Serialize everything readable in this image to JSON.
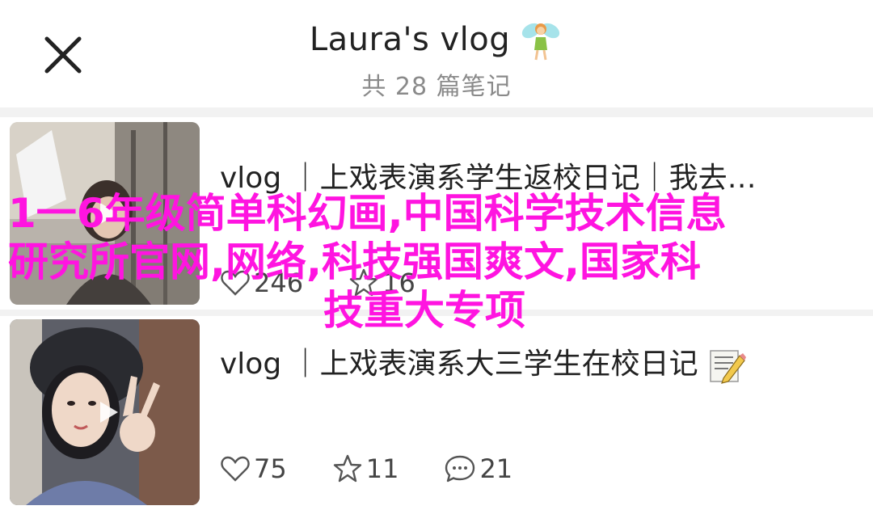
{
  "header": {
    "title": "Laura's vlog",
    "subtitle": "共 28 篇笔记",
    "close_icon": "close-icon",
    "title_emoji": "fairy-emoji"
  },
  "notes": [
    {
      "title": "vlog ｜上戏表演系学生返校日记｜我去…",
      "likes": "246",
      "stars": "16",
      "comments": ""
    },
    {
      "title": "vlog ｜上戏表演系大三学生在校日记",
      "likes": "75",
      "stars": "11",
      "comments": "21"
    }
  ],
  "overlay": {
    "line1": "1一6年级简单科幻画,中国科学技术信息",
    "line2": "研究所官网,网络,科技强国爽文,国家科",
    "line3": "技重大专项"
  },
  "colors": {
    "overlay_text": "#ff14e0",
    "title_text": "#222222",
    "subtitle_text": "#8a8a8a"
  }
}
